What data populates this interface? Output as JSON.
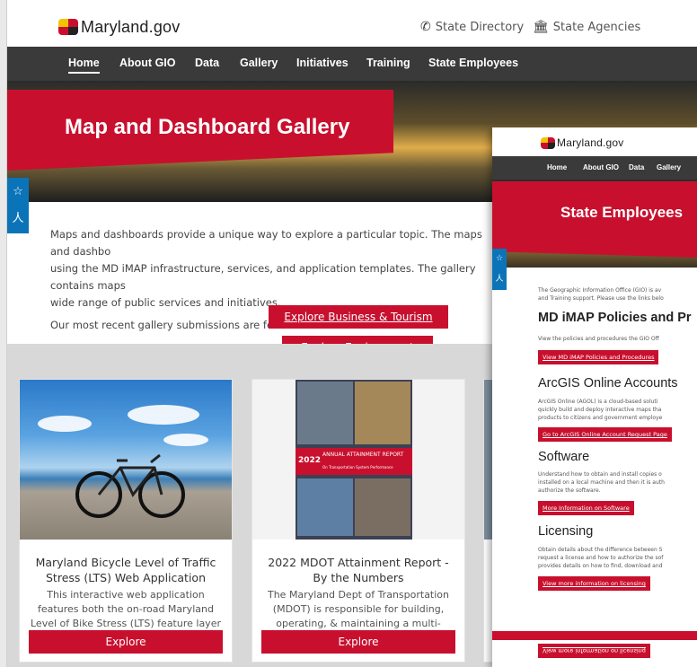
{
  "main": {
    "brand": "Maryland.gov",
    "utility": {
      "directory": "State Directory",
      "agencies": "State Agencies"
    },
    "nav": [
      "Home",
      "About GIO",
      "Data",
      "Gallery",
      "Initiatives",
      "Training",
      "State Employees"
    ],
    "hero_title": "Map and Dashboard Gallery",
    "intro": [
      "Maps and dashboards provide a unique way to explore a particular topic. The maps and dashbo",
      "using the MD iMAP infrastructure, services, and application templates. The gallery contains maps",
      "wide range of public services and initiatives."
    ],
    "recent": "Our most recent gallery submissions are featured below.",
    "cta_business": "Explore Business & Tourism Gallery",
    "cta_environment": "Explore Environment Gallery",
    "cards": [
      {
        "title": "Maryland Bicycle Level of Traffic Stress (LTS) Web Application",
        "desc": "This interactive web application features both the on-road Maryland Level of Bike Stress (LTS) feature layer for all road...",
        "button": "Explore"
      },
      {
        "title": "2022 MDOT Attainment Report - By the Numbers",
        "desc": "The Maryland Dept of Transportation (MDOT) is responsible for building, operating, & maintaining a multi-modal..",
        "button": "Explore",
        "cover_year": "2022",
        "cover_title": "ANNUAL ATTAINMENT REPORT",
        "cover_sub": "On Transportation System Performance"
      }
    ]
  },
  "overlay": {
    "brand": "Maryland.gov",
    "nav": [
      "Home",
      "About GIO",
      "Data",
      "Gallery"
    ],
    "hero_title": "State Employees",
    "intro": [
      "The Geographic Information Office (GIO) is av",
      "and Training support. Please use the links belo"
    ],
    "sections": [
      {
        "heading": "MD iMAP Policies and Pr",
        "text": [
          "View the policies and procedures the GIO Off"
        ],
        "button": "View MD iMAP Policies and Procedures"
      },
      {
        "heading": "ArcGIS Online Accounts",
        "text": [
          "ArcGIS Online (AGOL) is a cloud-based soluti",
          "quickly build and deploy interactive maps tha",
          "products to citizens and government employe"
        ],
        "button": "Go to ArcGIS Online Account Request Page"
      },
      {
        "heading": "Software",
        "text": [
          "Understand how to obtain and install copies o",
          "installed on a local machine and then it is auth",
          "authorize the software."
        ],
        "button": "More Information on Software"
      },
      {
        "heading": "Licensing",
        "text": [
          "Obtain details about the difference between S",
          "request a license and how to authorize the sof",
          "provides details on how to find, download and"
        ],
        "button": "View more information on licensing"
      }
    ],
    "flipped_button": "View more information on licensing"
  },
  "colors": {
    "brand_red": "#c8102e",
    "nav_dark": "#3a3a3a",
    "tool_blue": "#0b74b8"
  }
}
